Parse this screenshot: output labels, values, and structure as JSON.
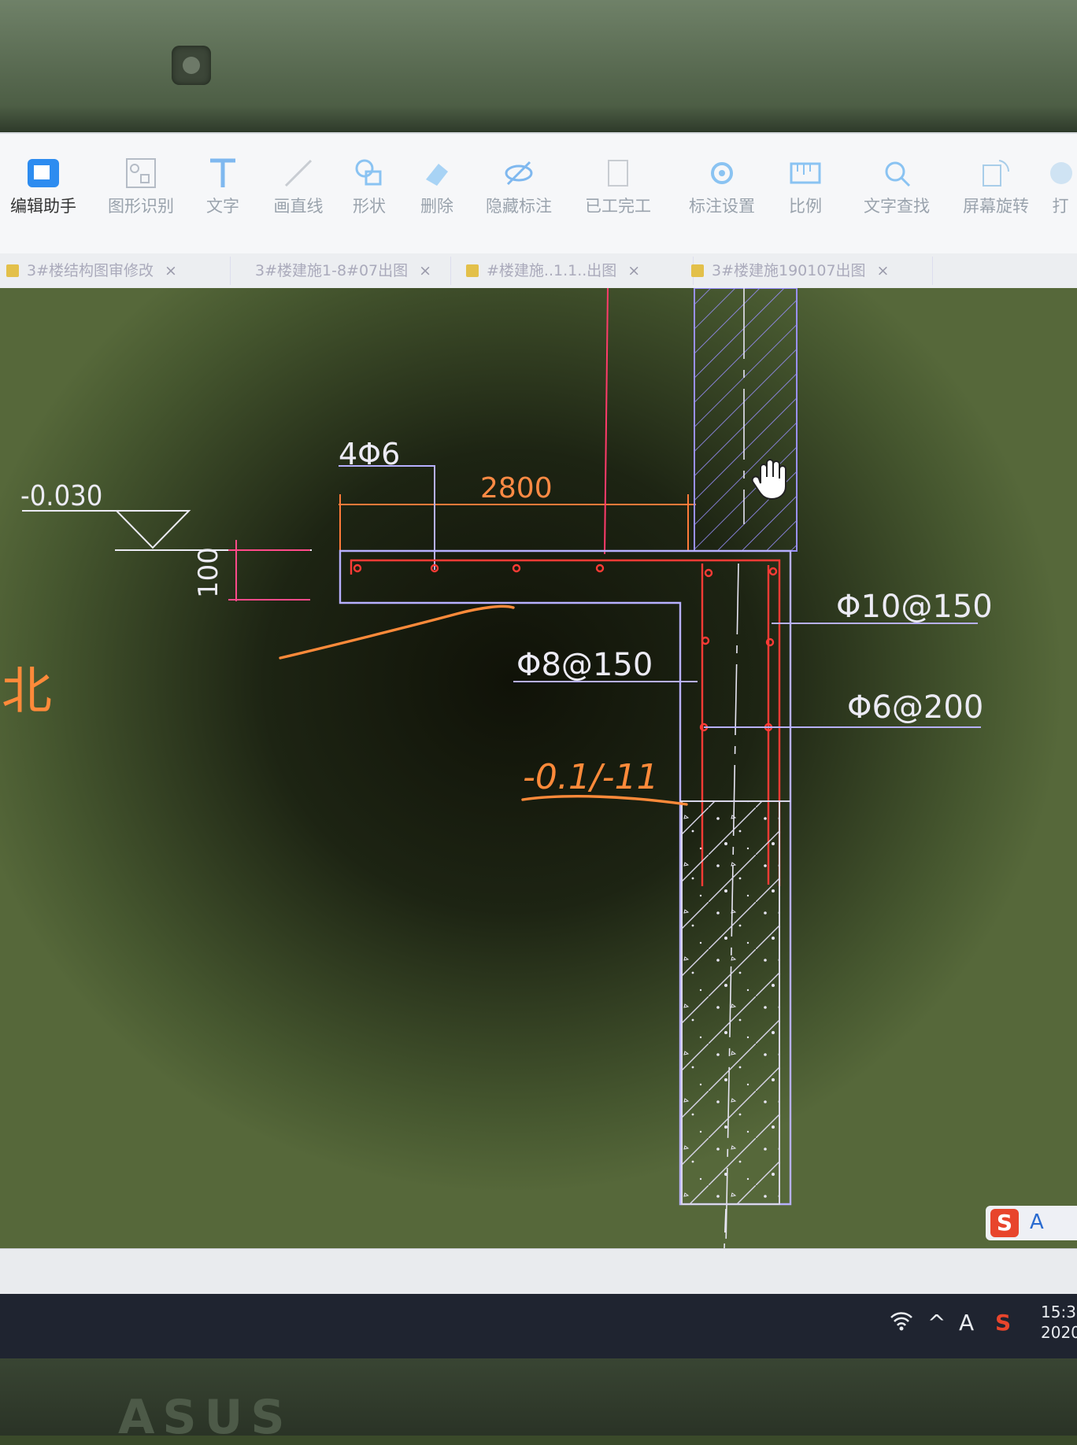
{
  "toolbar": {
    "items": [
      {
        "label": "编辑助手",
        "icon": "edit-assistant-icon"
      },
      {
        "label": "图形识别",
        "icon": "shape-recognition-icon"
      },
      {
        "label": "文字",
        "icon": "text-icon"
      },
      {
        "label": "画直线",
        "icon": "line-icon"
      },
      {
        "label": "形状",
        "icon": "shape-icon"
      },
      {
        "label": "删除",
        "icon": "eraser-icon"
      },
      {
        "label": "隐藏标注",
        "icon": "hide-annotation-icon"
      },
      {
        "label": "已工完工",
        "icon": "clipboard-icon"
      },
      {
        "label": "标注设置",
        "icon": "annotation-settings-icon"
      },
      {
        "label": "比例",
        "icon": "scale-icon"
      },
      {
        "label": "文字查找",
        "icon": "text-search-icon"
      },
      {
        "label": "屏幕旋转",
        "icon": "rotate-screen-icon"
      },
      {
        "label": "打",
        "icon": "print-icon"
      }
    ]
  },
  "tabs": [
    {
      "label": "3#楼结构图审修改"
    },
    {
      "label": "3#楼建施1-8#07出图"
    },
    {
      "label": "#楼建施..1.1..出图"
    },
    {
      "label": "3#楼建施190107出图"
    }
  ],
  "drawing": {
    "elevation": "-0.030",
    "top_bar_label": "4Φ6",
    "span_dim": "2800",
    "slab_thickness": "100",
    "rebar_1": "Φ10@150",
    "rebar_2": "Φ8@150",
    "rebar_3": "Φ6@200",
    "handwritten_1": "北",
    "handwritten_2": "-0.1/-11"
  },
  "ime": {
    "logo": "S",
    "mode": "A"
  },
  "taskbar": {
    "clock_time": "15:3",
    "clock_date": "2020"
  },
  "bezel": {
    "brand": "ASUS"
  },
  "colors": {
    "cad_white": "#e8e6f4",
    "cad_purple": "#9a90ff",
    "cad_red": "#ff3b35",
    "cad_orange": "#ff7a3a",
    "cad_magenta": "#ff4a8a",
    "handwriting": "#ff8a3a"
  }
}
